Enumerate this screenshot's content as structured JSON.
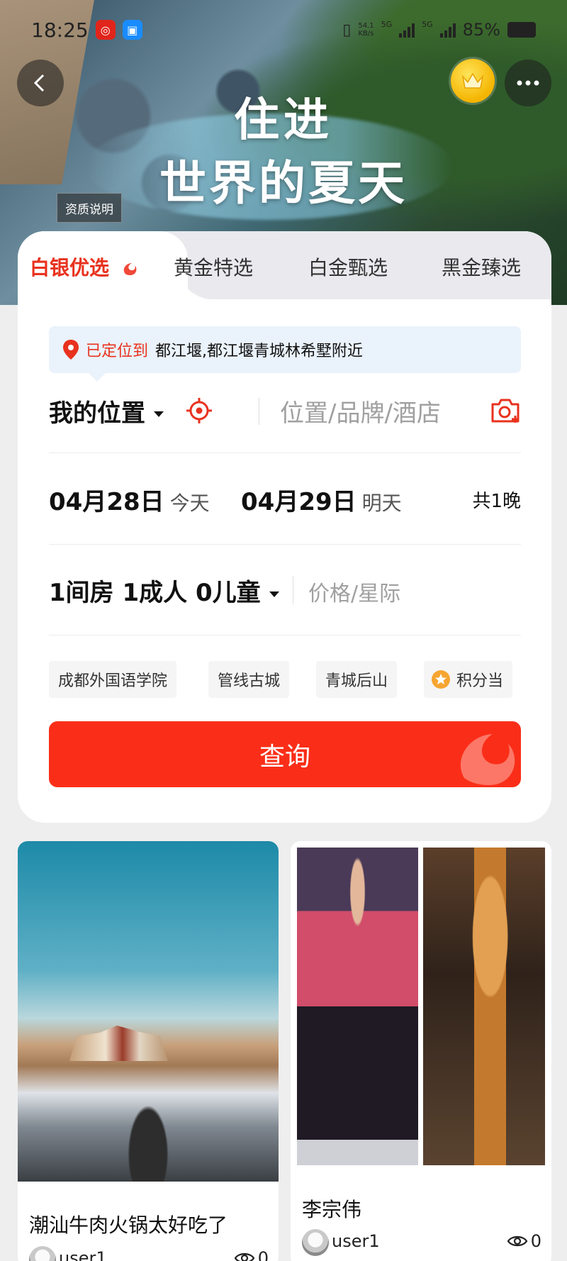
{
  "status_bar": {
    "time": "18:25",
    "network_top": "54.1",
    "network_bottom": "KB/s",
    "sim1": "5G",
    "sim2": "5G",
    "battery": "85%"
  },
  "hero": {
    "title_line1": "住进",
    "title_line2": "世界的夏天",
    "qualification_label": "资质说明"
  },
  "tabs": [
    {
      "label": "白银优选",
      "active": true
    },
    {
      "label": "黄金特选",
      "active": false
    },
    {
      "label": "白金甄选",
      "active": false
    },
    {
      "label": "黑金臻选",
      "active": false
    }
  ],
  "location_banner": {
    "status": "已定位到",
    "address": "都江堰,都江堰青城林希墅附近"
  },
  "search": {
    "my_location": "我的位置",
    "keyword_placeholder": "位置/品牌/酒店"
  },
  "dates": {
    "checkin": "04月28日",
    "checkin_note": "今天",
    "checkout": "04月29日",
    "checkout_note": "明天",
    "nights": "共1晚"
  },
  "guests": {
    "summary": "1间房 1成人 0儿童",
    "price_placeholder": "价格/星际"
  },
  "quick_chips": [
    "成都外国语学院",
    "管线古城",
    "青城后山",
    "积分当"
  ],
  "query_button": "查询",
  "feed": [
    {
      "title": "潮汕牛肉火锅太好吃了",
      "user": "user1",
      "views": "0"
    },
    {
      "title": "李宗伟",
      "user": "user1",
      "views": "0"
    }
  ],
  "colors": {
    "accent_red": "#fa2e18",
    "active_tab_red": "#e8321e",
    "banner_bg": "#eaf2fb",
    "crown_gold": "#f4b400"
  }
}
